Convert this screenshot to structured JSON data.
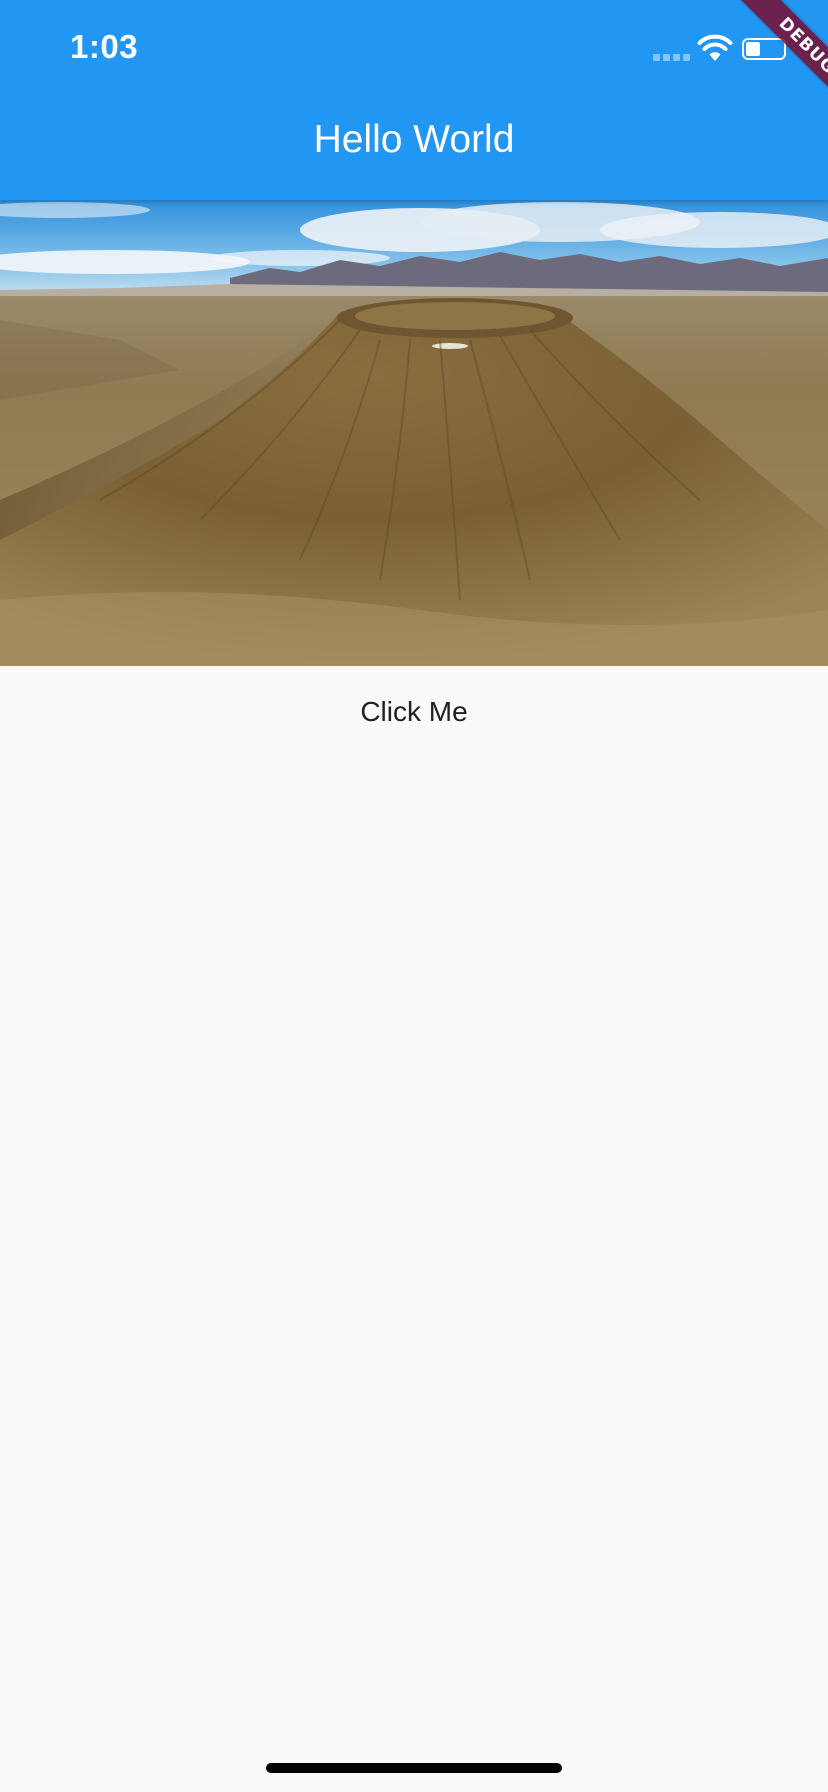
{
  "status_bar": {
    "time": "1:03",
    "signal_icon": "cellular-signal-icon",
    "wifi_icon": "wifi-icon",
    "battery_icon": "battery-icon"
  },
  "app_bar": {
    "title": "Hello World",
    "color": "#2196f3"
  },
  "debug_banner": {
    "label": "DEBUG",
    "color": "#800020"
  },
  "hero": {
    "image": "volcano-crater-landscape-photo"
  },
  "main": {
    "button_label": "Click Me"
  },
  "colors": {
    "background": "#fafafa",
    "text": "#212121"
  }
}
